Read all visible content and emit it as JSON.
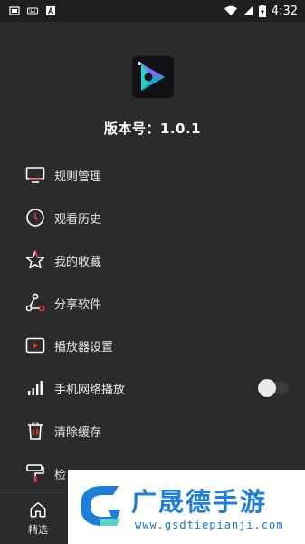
{
  "status_bar": {
    "time": "4:32",
    "left_icons": [
      "screen-icon",
      "keyboard-icon",
      "text-icon"
    ],
    "right_icons": [
      "wifi-icon",
      "signal-icon",
      "battery-charging-icon"
    ]
  },
  "header": {
    "version_text": "版本号：1.0.1"
  },
  "menu": {
    "items": [
      {
        "label": "规则管理",
        "icon": "monitor-icon"
      },
      {
        "label": "观看历史",
        "icon": "clock-icon"
      },
      {
        "label": "我的收藏",
        "icon": "star-icon"
      },
      {
        "label": "分享软件",
        "icon": "share-icon"
      },
      {
        "label": "播放器设置",
        "icon": "player-settings-icon"
      },
      {
        "label": "手机网络播放",
        "icon": "signal-bars-icon",
        "toggle": false
      },
      {
        "label": "清除缓存",
        "icon": "trash-icon"
      },
      {
        "label": "检",
        "icon": "paint-roller-icon"
      }
    ]
  },
  "bottom_nav": {
    "tabs": [
      {
        "label": "精选",
        "icon": "home-icon"
      }
    ]
  },
  "watermark": {
    "text": "广晟德手游",
    "url": "www.gsdtiepianji.com"
  },
  "colors": {
    "background": "#2b2b2b",
    "accent_red": "#e53935",
    "watermark_blue": "#1f7fd8"
  }
}
